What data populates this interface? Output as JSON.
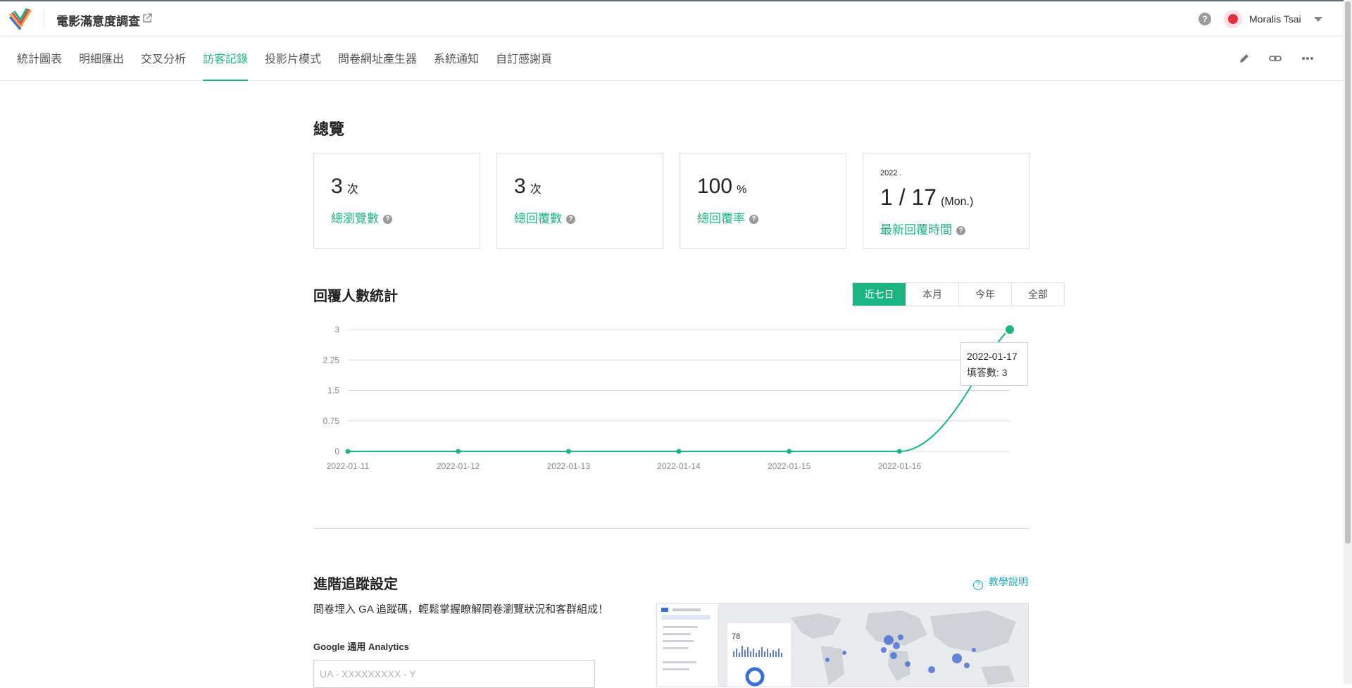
{
  "header": {
    "app_title": "電影滿意度調查",
    "user_name": "Moralis Tsai",
    "help_symbol": "?"
  },
  "nav": {
    "tabs": [
      "統計圖表",
      "明細匯出",
      "交叉分析",
      "訪客記錄",
      "投影片模式",
      "問卷網址產生器",
      "系統通知",
      "自訂感謝頁"
    ],
    "active_tab": "訪客記錄"
  },
  "overview": {
    "title": "總覽",
    "cards": [
      {
        "value": "3",
        "unit": "次",
        "label": "總瀏覽數"
      },
      {
        "value": "3",
        "unit": "次",
        "label": "總回覆數"
      },
      {
        "value": "100",
        "unit": "%",
        "label": "總回覆率"
      }
    ],
    "latest": {
      "year": "2022 .",
      "date": "1 / 17",
      "weekday": "(Mon.)",
      "label": "最新回覆時間"
    },
    "help_mark": "?"
  },
  "responses": {
    "title": "回覆人數統計",
    "ranges": [
      "近七日",
      "本月",
      "今年",
      "全部"
    ],
    "active_range": "近七日",
    "tooltip": {
      "date": "2022-01-17",
      "label": "填答數: 3"
    }
  },
  "chart_data": {
    "type": "line",
    "title": "",
    "xlabel": "",
    "ylabel": "",
    "categories": [
      "2022-01-11",
      "2022-01-12",
      "2022-01-13",
      "2022-01-14",
      "2022-01-15",
      "2022-01-16",
      "2022-01-17"
    ],
    "x_tick_labels": [
      "2022-01-11",
      "2022-01-12",
      "2022-01-13",
      "2022-01-14",
      "2022-01-15",
      "2022-01-16"
    ],
    "values": [
      0,
      0,
      0,
      0,
      0,
      0,
      3
    ],
    "y_ticks": [
      "0",
      "0.75",
      "1.5",
      "2.25",
      "3"
    ],
    "ylim": [
      0,
      3
    ],
    "grid": true,
    "color": "#1bb583"
  },
  "advanced": {
    "title": "進階追蹤設定",
    "help_link": "教學說明",
    "description": "問卷埋入 GA 追蹤碼，輕鬆掌握瞭解問卷瀏覽狀況和客群組成！",
    "ga_label": "Google 通用 Analytics",
    "ga_placeholder": "UA - XXXXXXXXX - Y",
    "preview_stat": "78"
  },
  "colors": {
    "accent": "#1bb583",
    "link": "#1bb0c0"
  }
}
